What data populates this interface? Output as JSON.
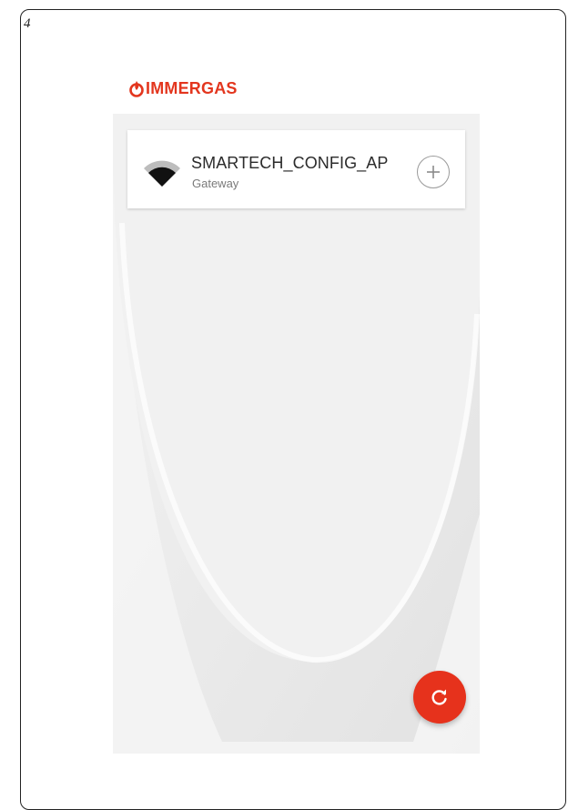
{
  "page_number": "4",
  "brand": {
    "name": "IMMERGAS",
    "color": "#e3361e"
  },
  "devices": [
    {
      "name": "SMARTECH_CONFIG_AP",
      "type": "Gateway",
      "signal_icon": "wifi-signal-icon",
      "action_icon": "add-icon"
    }
  ],
  "fab": {
    "icon": "refresh-icon",
    "color": "#e6321c"
  }
}
